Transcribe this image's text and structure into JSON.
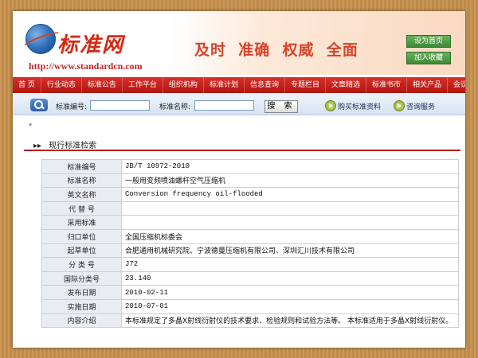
{
  "header": {
    "logo_text": "标准网",
    "url": "http://www.standardcn.com",
    "slogan": "及时  准确  权威  全面",
    "btn_home": "设为首页",
    "btn_fav": "加入收藏"
  },
  "nav": [
    "首 页",
    "行业动态",
    "标准公告",
    "工作平台",
    "组织机构",
    "标准计划",
    "信息查询",
    "专题栏目",
    "文章精选",
    "标准书市",
    "相关产品",
    "会议直播"
  ],
  "search": {
    "code_label": "标准编号:",
    "name_label": "标准名称:",
    "button": "搜 索",
    "buy_link": "购买标准资料",
    "consult_link": "咨询服务"
  },
  "section": {
    "bullet": "▸▸",
    "title": "现行标准检索"
  },
  "details": [
    {
      "key": "标准编号",
      "value": "JB/T 10972-2010",
      "mono": true
    },
    {
      "key": "标准名称",
      "value": "一般用变频喷油螺杆空气压缩机",
      "mono": false
    },
    {
      "key": "英文名称",
      "value": "Conversion frequency oil-flooded",
      "mono": true
    },
    {
      "key": "代 替 号",
      "value": "",
      "mono": false
    },
    {
      "key": "采用标准",
      "value": "",
      "mono": false
    },
    {
      "key": "归口单位",
      "value": "全国压缩机标委会",
      "mono": false
    },
    {
      "key": "起草单位",
      "value": "合肥通用机械研究院、宁波德曼压缩机有限公司、深圳汇川技术有限公司",
      "mono": false
    },
    {
      "key": "分 类 号",
      "value": "J72",
      "mono": true
    },
    {
      "key": "国际分类号",
      "value": "23.140",
      "mono": true
    },
    {
      "key": "发布日期",
      "value": "2010-02-11",
      "mono": true
    },
    {
      "key": "实施日期",
      "value": "2010-07-01",
      "mono": true
    },
    {
      "key": "内容介绍",
      "value": "本标准规定了多晶X射线衍射仪的技术要求、检验规则和试验方法等。 本标准适用于多晶X射线衍射仪。",
      "mono": false
    }
  ]
}
